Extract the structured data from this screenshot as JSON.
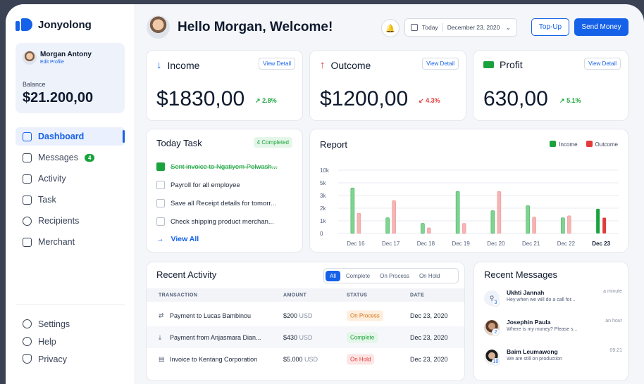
{
  "app": {
    "name": "Jonyolong"
  },
  "profile": {
    "name": "Morgan Antony",
    "edit": "Edit Profile",
    "balance_label": "Balance",
    "balance": "$21.200,00"
  },
  "nav": [
    {
      "label": "Dashboard",
      "icon": "cube-icon",
      "active": true
    },
    {
      "label": "Messages",
      "icon": "mail-icon",
      "badge": "4"
    },
    {
      "label": "Activity",
      "icon": "clipboard-icon"
    },
    {
      "label": "Task",
      "icon": "note-icon"
    },
    {
      "label": "Recipients",
      "icon": "user-circle-icon"
    },
    {
      "label": "Merchant",
      "icon": "briefcase-icon"
    }
  ],
  "nav_bottom": [
    {
      "label": "Settings",
      "icon": "gear-icon"
    },
    {
      "label": "Help",
      "icon": "help-icon"
    },
    {
      "label": "Privacy",
      "icon": "shield-icon"
    }
  ],
  "header": {
    "greeting": "Hello Morgan, Welcome!",
    "date_prefix": "Today",
    "date": "December 23, 2020",
    "topup": "Top-Up",
    "send": "Send Money"
  },
  "stats": [
    {
      "title": "Income",
      "value": "$1830,00",
      "pct": "2.8%",
      "trend": "up",
      "view": "View Detail",
      "icon": "arrow-down-icon"
    },
    {
      "title": "Outcome",
      "value": "$1200,00",
      "pct": "4.3%",
      "trend": "down",
      "view": "View Detail",
      "icon": "arrow-up-icon"
    },
    {
      "title": "Profit",
      "value": "630,00",
      "pct": "5.1%",
      "trend": "up",
      "view": "View Detail",
      "icon": "cash-icon"
    }
  ],
  "tasks": {
    "title": "Today Task",
    "badge": "4 Completed",
    "items": [
      {
        "text": "Sent invoice to Ngatiyem Polwash...",
        "done": true
      },
      {
        "text": "Payroll for all employee",
        "done": false
      },
      {
        "text": "Save all Receipt details for tomorr...",
        "done": false
      },
      {
        "text": "Check shipping product merchan...",
        "done": false
      }
    ],
    "view_all": "View All"
  },
  "chart_data": {
    "type": "bar",
    "title": "Report",
    "categories": [
      "Dec 16",
      "Dec 17",
      "Dec 18",
      "Dec 19",
      "Dec 20",
      "Dec 21",
      "Dec 22",
      "Dec 23"
    ],
    "series": [
      {
        "name": "Income",
        "values": [
          4200,
          1250,
          800,
          3650,
          1800,
          2200,
          1250,
          1950
        ]
      },
      {
        "name": "Outcome",
        "values": [
          1600,
          2600,
          450,
          800,
          3650,
          1300,
          1400,
          1250
        ]
      }
    ],
    "ylim": [
      0,
      10000
    ],
    "yticks": [
      "0",
      "1k",
      "2k",
      "3k",
      "5k",
      "10k"
    ],
    "colors": {
      "income": "#1aa33d",
      "outcome": "#e23b3b",
      "income_light": "#7fd491",
      "outcome_light": "#f6b4b4"
    },
    "highlight": "Dec 23"
  },
  "activity": {
    "title": "Recent Activity",
    "filters": [
      "All",
      "Complete",
      "On Process",
      "On Hold"
    ],
    "columns": [
      "TRANSACTION",
      "AMOUNT",
      "STATUS",
      "DATE"
    ],
    "rows": [
      {
        "icon": "transfer-icon",
        "name": "Payment to Lucas Bambinou",
        "amount": "$200",
        "cur": "USD",
        "status": "On Process",
        "date": "Dec 23, 2020"
      },
      {
        "icon": "download-icon",
        "name": "Payment from Anjasmara Dian...",
        "amount": "$430",
        "cur": "USD",
        "status": "Complete",
        "date": "Dec 23, 2020"
      },
      {
        "icon": "invoice-icon",
        "name": "Invoice to Kentang Corporation",
        "amount": "$5.000",
        "cur": "USD",
        "status": "On Hold",
        "date": "Dec 23, 2020"
      }
    ]
  },
  "messages": {
    "title": "Recent Messages",
    "items": [
      {
        "name": "Ukhti Jannah",
        "text": "Hey when we will do a call for...",
        "time": "a minute",
        "count": "3"
      },
      {
        "name": "Josephin Paula",
        "text": "Where is my money? Please s...",
        "time": "an hour",
        "count": "2"
      },
      {
        "name": "Baim Leumawong",
        "text": "We are still on production",
        "time": "09:21",
        "count": "10"
      }
    ]
  }
}
